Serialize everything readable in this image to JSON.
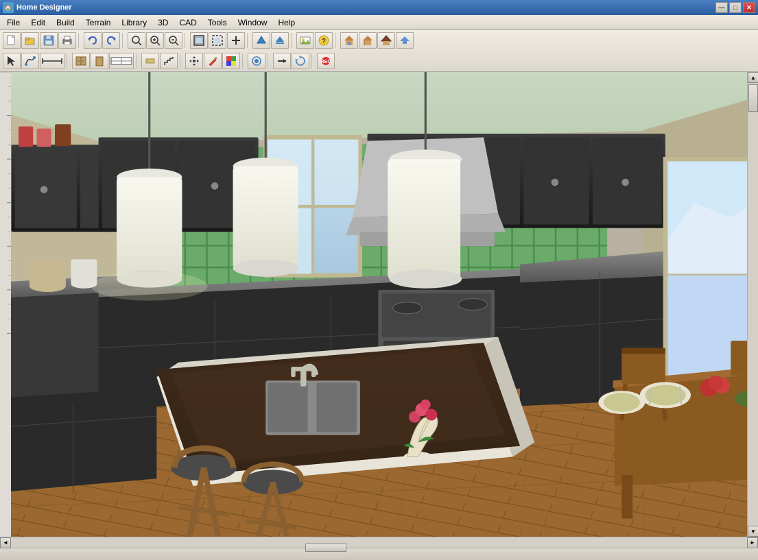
{
  "app": {
    "title": "Home Designer",
    "icon": "🏠"
  },
  "title_bar": {
    "title": "Home Designer",
    "controls": {
      "minimize": "—",
      "maximize": "□",
      "close": "✕"
    }
  },
  "menu": {
    "items": [
      {
        "id": "file",
        "label": "File"
      },
      {
        "id": "edit",
        "label": "Edit"
      },
      {
        "id": "build",
        "label": "Build"
      },
      {
        "id": "terrain",
        "label": "Terrain"
      },
      {
        "id": "library",
        "label": "Library"
      },
      {
        "id": "3d",
        "label": "3D"
      },
      {
        "id": "cad",
        "label": "CAD"
      },
      {
        "id": "tools",
        "label": "Tools"
      },
      {
        "id": "window",
        "label": "Window"
      },
      {
        "id": "help",
        "label": "Help"
      }
    ]
  },
  "toolbar": {
    "row1": {
      "buttons": [
        {
          "id": "new",
          "icon": "📄",
          "tooltip": "New"
        },
        {
          "id": "open",
          "icon": "📂",
          "tooltip": "Open"
        },
        {
          "id": "save",
          "icon": "💾",
          "tooltip": "Save"
        },
        {
          "id": "print",
          "icon": "🖨",
          "tooltip": "Print"
        },
        {
          "id": "undo",
          "icon": "↩",
          "tooltip": "Undo"
        },
        {
          "id": "redo",
          "icon": "↪",
          "tooltip": "Redo"
        },
        {
          "id": "zoom-in-out",
          "icon": "🔍",
          "tooltip": "Zoom"
        },
        {
          "id": "zoom-in",
          "icon": "+🔍",
          "tooltip": "Zoom In"
        },
        {
          "id": "zoom-out",
          "icon": "-🔍",
          "tooltip": "Zoom Out"
        },
        {
          "id": "fit",
          "icon": "⊞",
          "tooltip": "Fit"
        },
        {
          "id": "select-all",
          "icon": "⊟",
          "tooltip": "Select All"
        },
        {
          "id": "add",
          "icon": "+",
          "tooltip": "Add"
        },
        {
          "id": "arrow-up",
          "icon": "↑",
          "tooltip": "Arrow Up"
        },
        {
          "id": "arrow-up2",
          "icon": "⬆",
          "tooltip": "Up"
        },
        {
          "id": "image",
          "icon": "🖼",
          "tooltip": "Image"
        },
        {
          "id": "help-btn",
          "icon": "?",
          "tooltip": "Help"
        },
        {
          "id": "house1",
          "icon": "🏠",
          "tooltip": "House"
        },
        {
          "id": "house2",
          "icon": "🏡",
          "tooltip": "House 2"
        },
        {
          "id": "roof",
          "icon": "⌂",
          "tooltip": "Roof"
        },
        {
          "id": "export",
          "icon": "⬆",
          "tooltip": "Export"
        }
      ]
    },
    "row2": {
      "buttons": [
        {
          "id": "select",
          "icon": "↖",
          "tooltip": "Select"
        },
        {
          "id": "polyline",
          "icon": "⌒",
          "tooltip": "Polyline"
        },
        {
          "id": "dimension",
          "icon": "⟺",
          "tooltip": "Dimension"
        },
        {
          "id": "cabinet",
          "icon": "▦",
          "tooltip": "Cabinet"
        },
        {
          "id": "door",
          "icon": "🚪",
          "tooltip": "Door"
        },
        {
          "id": "window-btn",
          "icon": "⬜",
          "tooltip": "Window"
        },
        {
          "id": "wall",
          "icon": "▬",
          "tooltip": "Wall"
        },
        {
          "id": "stair",
          "icon": "≡",
          "tooltip": "Stair"
        },
        {
          "id": "move",
          "icon": "✥",
          "tooltip": "Move"
        },
        {
          "id": "paint",
          "icon": "🖌",
          "tooltip": "Paint"
        },
        {
          "id": "material",
          "icon": "🎨",
          "tooltip": "Material"
        },
        {
          "id": "symbol",
          "icon": "◎",
          "tooltip": "Symbol"
        },
        {
          "id": "arrow-tool",
          "icon": "→",
          "tooltip": "Arrow"
        },
        {
          "id": "transform",
          "icon": "⟳",
          "tooltip": "Transform"
        },
        {
          "id": "record",
          "icon": "⏺",
          "tooltip": "Record"
        }
      ]
    }
  },
  "canvas": {
    "background": "3D Kitchen View"
  },
  "status_bar": {
    "text": ""
  },
  "scrollbar": {
    "up_arrow": "▲",
    "down_arrow": "▼",
    "left_arrow": "◄",
    "right_arrow": "►"
  }
}
